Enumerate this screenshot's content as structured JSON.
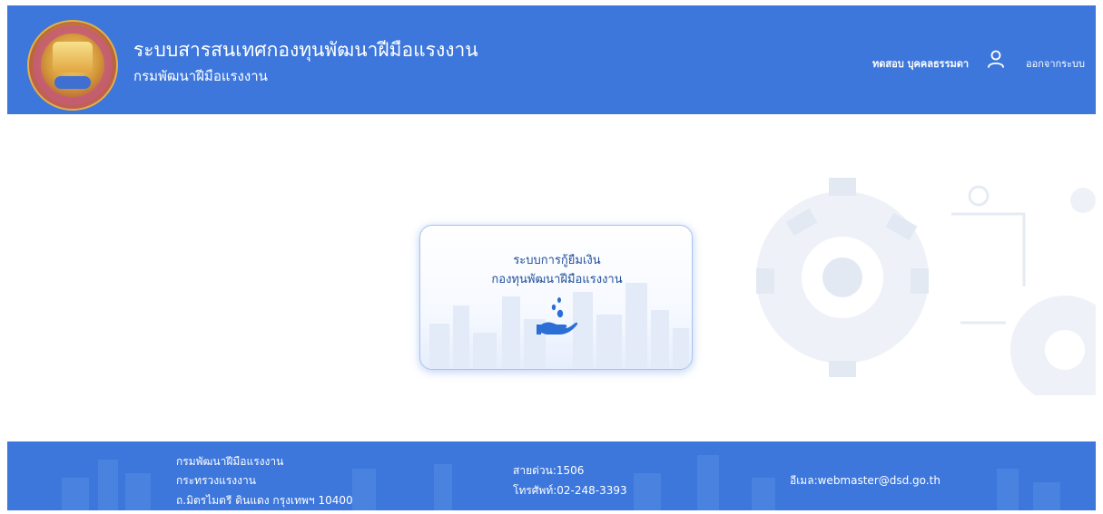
{
  "header": {
    "title": "ระบบสารสนเทศกองทุนพัฒนาฝีมือแรงงาน",
    "subtitle": "กรมพัฒนาฝีมือแรงงาน",
    "username": "ทดสอบ บุคคลธรรมดา",
    "logout_label": "ออกจากระบบ",
    "user_icon": "user-icon",
    "logo": "dsd-emblem-logo"
  },
  "main": {
    "card": {
      "line1": "ระบบการกู้ยืมเงิน",
      "line2": "กองทุนพัฒนาฝีมือแรงงาน",
      "icon": "loan-hand-icon"
    }
  },
  "footer": {
    "org_lines": [
      "กรมพัฒนาฝีมือแรงงาน",
      "กระทรวงแรงงาน",
      "ถ.มิตรไมตรี ดินแดง กรุงเทพฯ 10400"
    ],
    "hotline": "สายด่วน:1506",
    "phone": "โทรศัพท์:02-248-3393",
    "email": "อีเมล:webmaster@dsd.go.th"
  },
  "colors": {
    "brand_blue": "#3d77dc",
    "card_text": "#1f4e9c"
  }
}
